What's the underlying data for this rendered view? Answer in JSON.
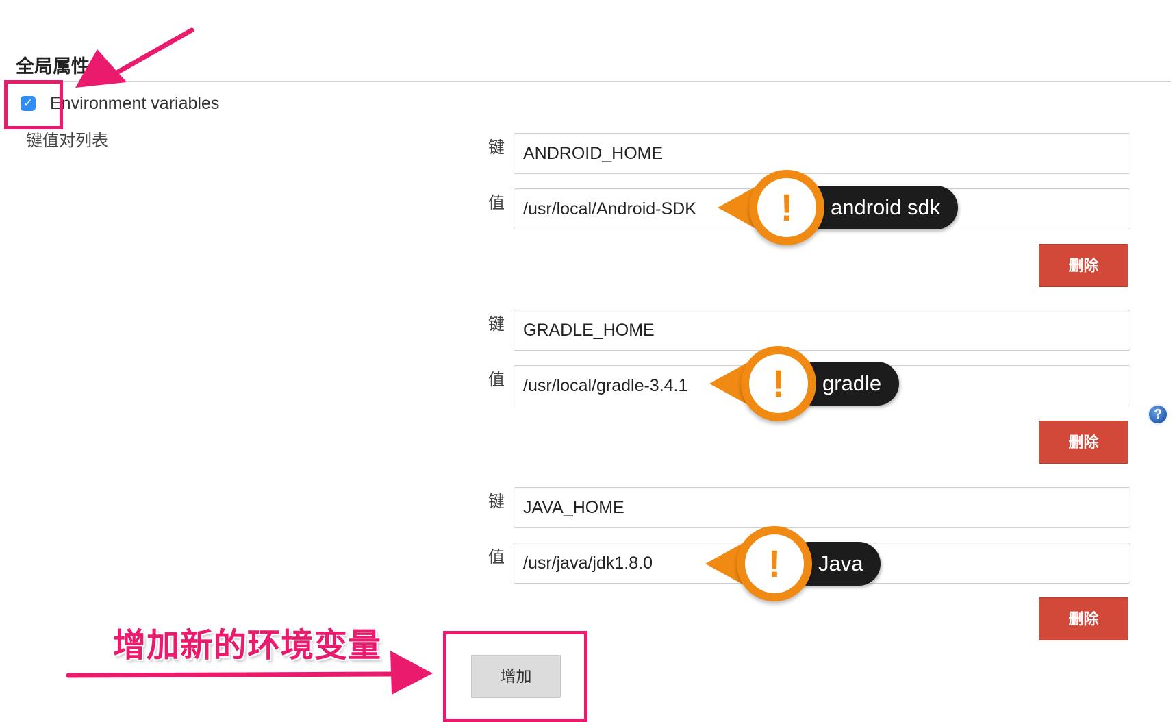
{
  "section_title": "全局属性",
  "env": {
    "label": "Environment variables",
    "checked": true
  },
  "kv_list_label": "键值对列表",
  "key_label": "键",
  "value_label": "值",
  "entries": [
    {
      "key": "ANDROID_HOME",
      "value": "/usr/local/Android-SDK",
      "callout": "android sdk"
    },
    {
      "key": "GRADLE_HOME",
      "value": "/usr/local/gradle-3.4.1",
      "callout": "gradle"
    },
    {
      "key": "JAVA_HOME",
      "value": "/usr/java/jdk1.8.0",
      "callout": "Java"
    }
  ],
  "delete_label": "删除",
  "add_label": "增加",
  "annotation_text": "增加新的环境变量",
  "icons": {
    "checkbox": "checkmark-icon",
    "help": "question-mark-icon",
    "callout": "exclamation-icon"
  },
  "colors": {
    "delete": "#d24939",
    "annotation": "#ea1b6d",
    "callout": "#f08a12",
    "checkbox": "#2f8cf4"
  }
}
